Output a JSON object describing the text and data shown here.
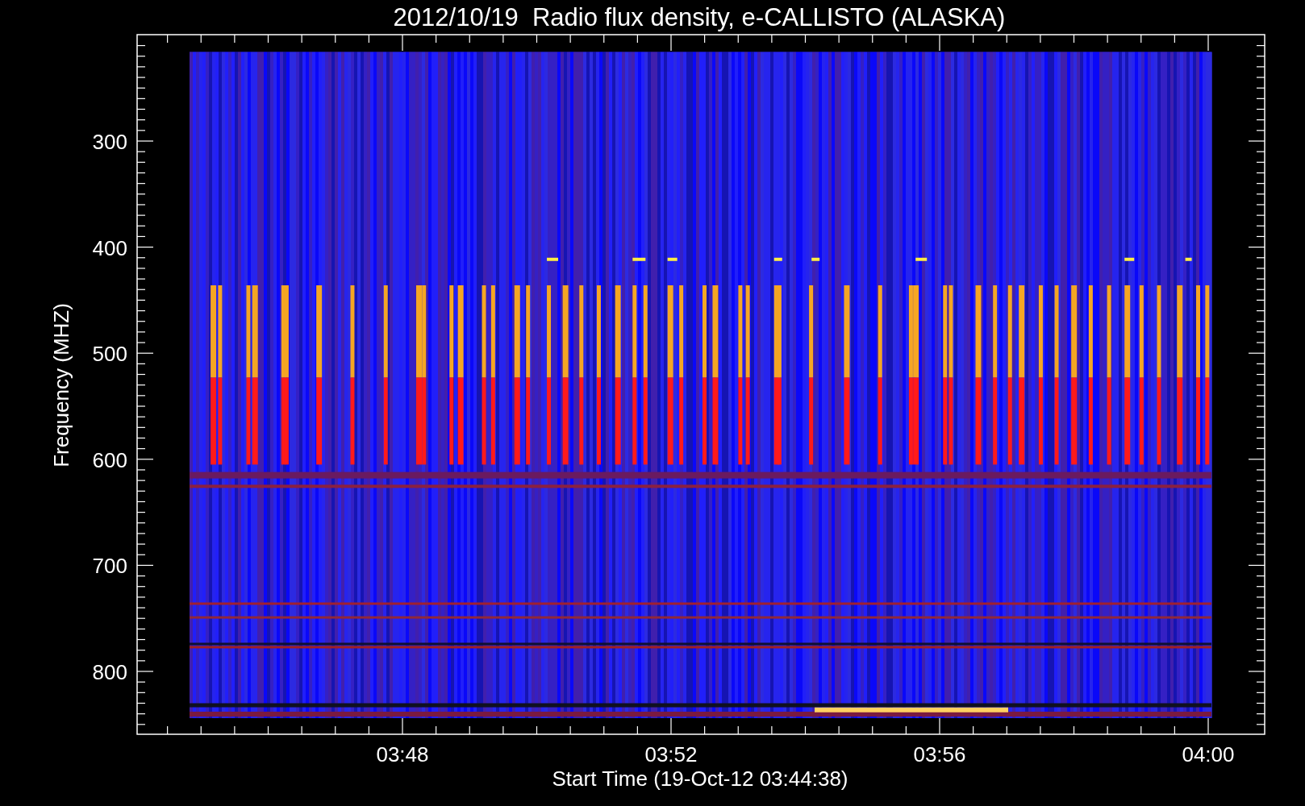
{
  "title": "2012/10/19  Radio flux density, e-CALLISTO (ALASKA)",
  "y_axis": {
    "label": "Frequency (MHZ)",
    "ticks": [
      "300",
      "400",
      "500",
      "600",
      "700",
      "800"
    ]
  },
  "x_axis": {
    "label": "Start Time (19-Oct-12 03:44:38)",
    "ticks": [
      "03:48",
      "03:52",
      "03:56",
      "04:00"
    ]
  }
}
